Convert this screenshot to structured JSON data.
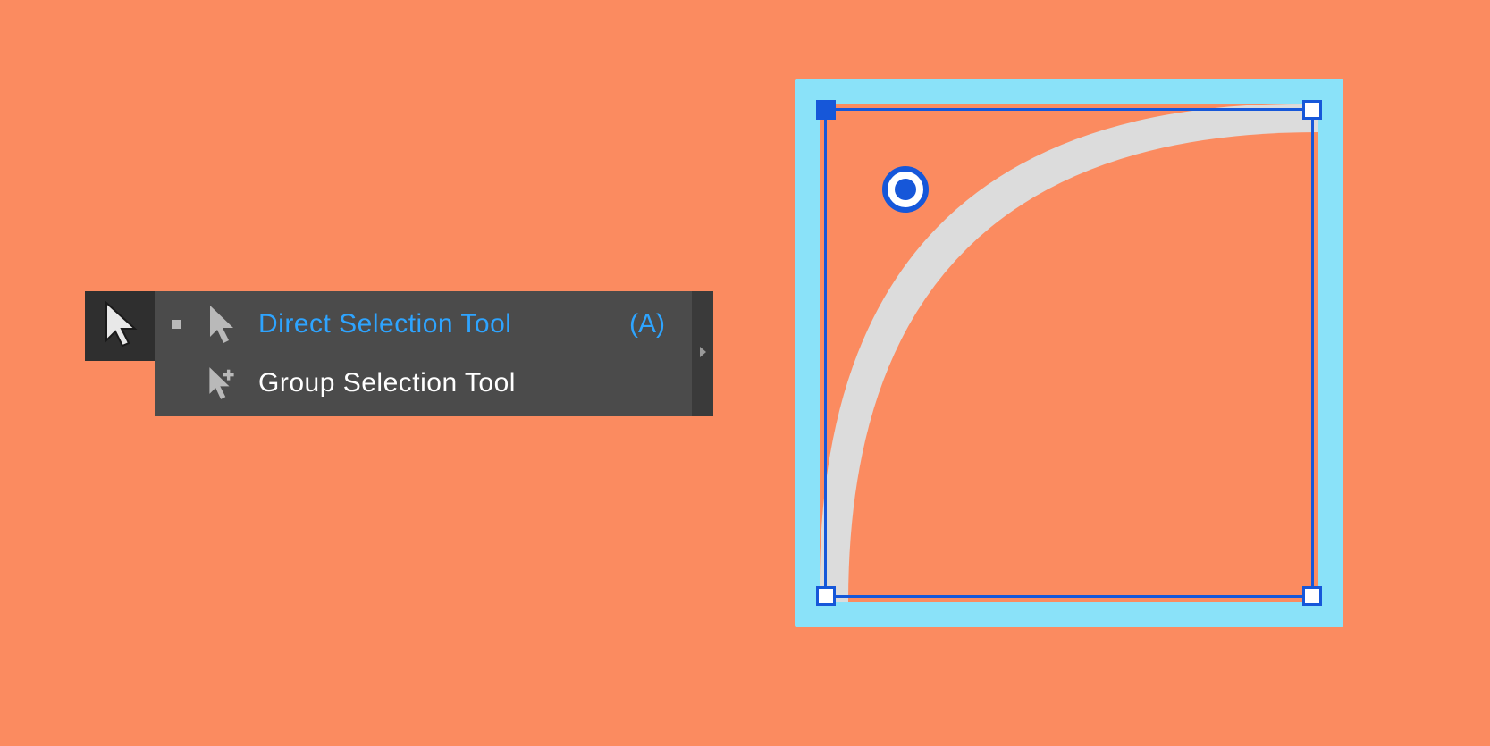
{
  "colors": {
    "background": "#fb8b60",
    "panel_dark": "#2f2f2f",
    "panel": "#4b4b4b",
    "highlight_text": "#2ea4ff",
    "selection_blue": "#1657d9",
    "frame_lightblue": "#8ae2f9",
    "curve_grey": "#dcdcdc"
  },
  "active_tool_icon": "direct-selection-arrow",
  "flyout": {
    "items": [
      {
        "label": "Direct Selection Tool",
        "shortcut": "(A)",
        "icon": "direct-selection-arrow",
        "selected": true
      },
      {
        "label": "Group Selection Tool",
        "shortcut": "",
        "icon": "group-selection-arrow",
        "selected": false
      }
    ],
    "tearoff_icon": "triangle-right"
  },
  "canvas": {
    "frame_icon": "rounded-rectangle-frame",
    "selected_anchor": "top-left",
    "corner_widget_icon": "live-corner-widget",
    "drag_indicator_icon": "drag-arrow"
  }
}
